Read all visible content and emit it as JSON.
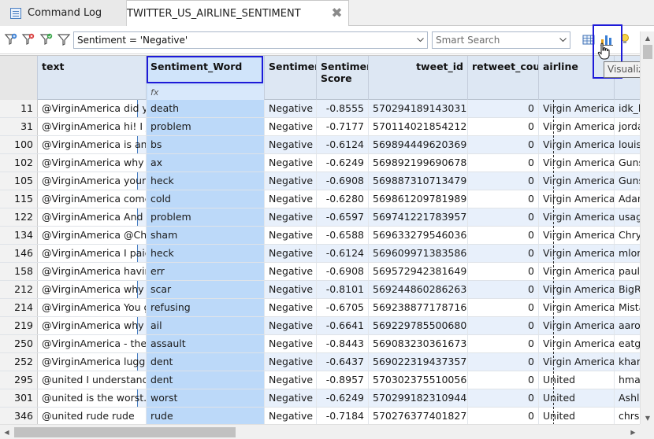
{
  "tabs": [
    {
      "label": "Command Log",
      "icon": "list-icon"
    },
    {
      "label": "TWITTER_US_AIRLINE_SENTIMENT",
      "icon": "table-icon",
      "close": "✖"
    }
  ],
  "toolbar": {
    "filter_value": "Sentiment = 'Negative'",
    "search_placeholder": "Smart Search",
    "tooltip": "Visualizations"
  },
  "columns": {
    "text": "text",
    "sentiment_word": "Sentiment_Word",
    "sentiment": "Sentiment",
    "sentiment_score": "Sentiment Score",
    "tweet_id": "tweet_id",
    "retweet_count": "retweet_count",
    "airline": "airline",
    "fx": "fx"
  },
  "rows": [
    {
      "n": "11",
      "text": "@VirginAmerica did you",
      "word": "death",
      "sent": "Negative",
      "score": "-0.8555",
      "id": "570294189143031000",
      "rt": "0",
      "air": "Virgin America",
      "user": "idk_b"
    },
    {
      "n": "31",
      "text": "@VirginAmerica hi! I just",
      "word": "problem",
      "sent": "Negative",
      "score": "-0.7177",
      "id": "570114021854212000",
      "rt": "0",
      "air": "Virgin America",
      "user": "jorda"
    },
    {
      "n": "100",
      "text": "@VirginAmerica is anyon",
      "word": "bs",
      "sent": "Negative",
      "score": "-0.6124",
      "id": "569894449620369000",
      "rt": "0",
      "air": "Virgin America",
      "user": "louisj"
    },
    {
      "n": "102",
      "text": "@VirginAmerica why mu",
      "word": "ax",
      "sent": "Negative",
      "score": "-0.6249",
      "id": "569892199690678000",
      "rt": "0",
      "air": "Virgin America",
      "user": "Guns"
    },
    {
      "n": "105",
      "text": "@VirginAmerica your no",
      "word": "heck",
      "sent": "Negative",
      "score": "-0.6908",
      "id": "569887310713479000",
      "rt": "0",
      "air": "Virgin America",
      "user": "Guns"
    },
    {
      "n": "115",
      "text": "@VirginAmerica come ba",
      "word": "cold",
      "sent": "Negative",
      "score": "-0.6280",
      "id": "569861209781989000",
      "rt": "0",
      "air": "Virgin America",
      "user": "Adan"
    },
    {
      "n": "122",
      "text": "@VirginAmerica And nov",
      "word": "problem",
      "sent": "Negative",
      "score": "-0.6597",
      "id": "569741221783957000",
      "rt": "0",
      "air": "Virgin America",
      "user": "usagi"
    },
    {
      "n": "134",
      "text": "@VirginAmerica @Chrysi",
      "word": "sham",
      "sent": "Negative",
      "score": "-0.6588",
      "id": "569633279546036000",
      "rt": "0",
      "air": "Virgin America",
      "user": "Chrys"
    },
    {
      "n": "146",
      "text": "@VirginAmerica I paid th",
      "word": "heck",
      "sent": "Negative",
      "score": "-0.6124",
      "id": "569609971383586000",
      "rt": "0",
      "air": "Virgin America",
      "user": "mlore"
    },
    {
      "n": "158",
      "text": "@VirginAmerica having p",
      "word": "err",
      "sent": "Negative",
      "score": "-0.6908",
      "id": "569572942381649000",
      "rt": "0",
      "air": "Virgin America",
      "user": "paulr"
    },
    {
      "n": "212",
      "text": "@VirginAmerica why Car",
      "word": "scar",
      "sent": "Negative",
      "score": "-0.8101",
      "id": "569244860286263000",
      "rt": "0",
      "air": "Virgin America",
      "user": "BigRi"
    },
    {
      "n": "214",
      "text": "@VirginAmerica You guy",
      "word": "refusing",
      "sent": "Negative",
      "score": "-0.6705",
      "id": "569238877178716000",
      "rt": "0",
      "air": "Virgin America",
      "user": "Mista"
    },
    {
      "n": "219",
      "text": "@VirginAmerica why Car",
      "word": "ail",
      "sent": "Negative",
      "score": "-0.6641",
      "id": "569229785500680000",
      "rt": "0",
      "air": "Virgin America",
      "user": "aaron"
    },
    {
      "n": "250",
      "text": "@VirginAmerica - the pa",
      "word": "assault",
      "sent": "Negative",
      "score": "-0.8443",
      "id": "569083230361673000",
      "rt": "0",
      "air": "Virgin America",
      "user": "eatgr"
    },
    {
      "n": "252",
      "text": "@VirginAmerica luggage",
      "word": "dent",
      "sent": "Negative",
      "score": "-0.6437",
      "id": "569022319437357000",
      "rt": "0",
      "air": "Virgin America",
      "user": "khart"
    },
    {
      "n": "295",
      "text": "@united I understand, bu",
      "word": "dent",
      "sent": "Negative",
      "score": "-0.8957",
      "id": "570302375510056000",
      "rt": "0",
      "air": "United",
      "user": "hmar"
    },
    {
      "n": "301",
      "text": "@united is the worst. Nor",
      "word": "worst",
      "sent": "Negative",
      "score": "-0.6249",
      "id": "570299182310944000",
      "rt": "0",
      "air": "United",
      "user": "Ashle"
    },
    {
      "n": "346",
      "text": "@united rude rude",
      "word": "rude",
      "sent": "Negative",
      "score": "-0.7184",
      "id": "570276377401827000",
      "rt": "0",
      "air": "United",
      "user": "chrsr"
    }
  ]
}
